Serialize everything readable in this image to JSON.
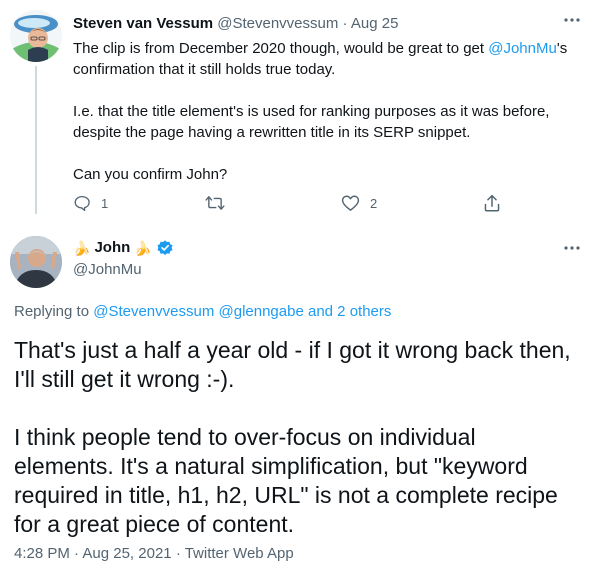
{
  "parent_tweet": {
    "display_name": "Steven van Vessum",
    "handle": "@Stevenvvessum",
    "separator": "·",
    "date": "Aug 25",
    "text_line1_a": "The clip is from December 2020 though, would be great to get ",
    "mention": "@JohnMu",
    "text_line1_b": "'s",
    "text_line2": "confirmation that it still holds true today.",
    "text_para2_line1": "I.e. that the title element's is used for ranking purposes as it was before,",
    "text_para2_line2": "despite the page having a rewritten title in its SERP snippet.",
    "text_para3": "Can you confirm John?",
    "reply_count": "1",
    "retweet_count": "",
    "like_count": "2"
  },
  "main_tweet": {
    "display_name": "John",
    "name_emoji_left": "🍌",
    "name_emoji_right": "🍌",
    "handle": "@JohnMu",
    "replying_prefix": "Replying to ",
    "replying_users": [
      "@Stevenvvessum",
      "@glenngabe"
    ],
    "replying_suffix": "and 2 others",
    "text_p1_line1": "That's just a half a year old - if I got it wrong back then,",
    "text_p1_line2": "I'll still get it wrong :-).",
    "text_p2_line1": "I think people tend to over-focus on individual",
    "text_p2_line2": "elements. It's a natural simplification, but \"keyword",
    "text_p2_line3": "required in title, h1, h2, URL\" is not a complete recipe",
    "text_p2_line4": "for a great piece of content.",
    "time": "4:28 PM",
    "date": "Aug 25, 2021",
    "source": "Twitter Web App",
    "separator": "·"
  },
  "icons": [
    "more-icon",
    "reply-icon",
    "retweet-icon",
    "like-icon",
    "share-icon",
    "verified-badge-icon"
  ],
  "colors": {
    "accent": "#1d9bf0",
    "muted": "#536471",
    "text": "#0f1419",
    "thread_line": "#cfd9de"
  }
}
